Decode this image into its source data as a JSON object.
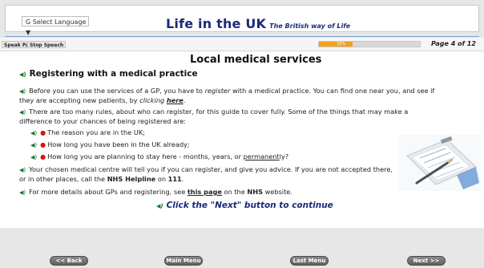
{
  "header": {
    "language_select": "G Select Language ▼",
    "title": "Life in the UK",
    "subtitle": "The British way of Life"
  },
  "controls": {
    "speak_page": "Speak Page",
    "stop_speech": "Stop Speech",
    "progress_percent": 33,
    "progress_label": "33%",
    "page_info": "Page 4 of 12"
  },
  "content": {
    "heading": "Local medical services",
    "section_title": "Registering with a medical practice",
    "paragraph1_a": "Before you can use the services of a GP, you have to",
    "paragraph1_register": "register",
    "paragraph1_b": "with a medical practice. You can find one near you, and see if they are accepting new patients, by",
    "paragraph1_clicking": "clicking",
    "paragraph1_here": "here",
    "paragraph1_end": ".",
    "paragraph2": "There are too many rules, about who can register, for this guide to cover fully. Some of the things that may make a difference to your chances of being registered are:",
    "bullet1": "The reason you are in the UK;",
    "bullet2": "How long you have been in the UK already;",
    "bullet3_a": "How long you are planning to stay here - months, years, or",
    "bullet3_permanent": "permanent",
    "bullet3_b": "ly?",
    "paragraph3_a": "Your chosen medical centre will tell you if you can register, and give you advice. If you are not accepted there, or in other places, call the",
    "paragraph3_helpline": "NHS Helpline",
    "paragraph3_on": "on",
    "paragraph3_number": "111",
    "paragraph3_end": ".",
    "paragraph4_a": "For more details about GPs and registering, see",
    "paragraph4_link": "this page",
    "paragraph4_b": "on the",
    "paragraph4_nhs": "NHS",
    "paragraph4_c": "website.",
    "continue_text": "Click the \"Next\" button to continue"
  },
  "footer": {
    "back": "<< Back",
    "main_menu": "Main Menu",
    "last_menu": "Last Menu",
    "next": "Next >>"
  },
  "colors": {
    "title": "#1a2a7a",
    "progress": "#f3a21a",
    "speaker_icon": "#0b7a29",
    "bullet_dot": "#dd1111"
  }
}
